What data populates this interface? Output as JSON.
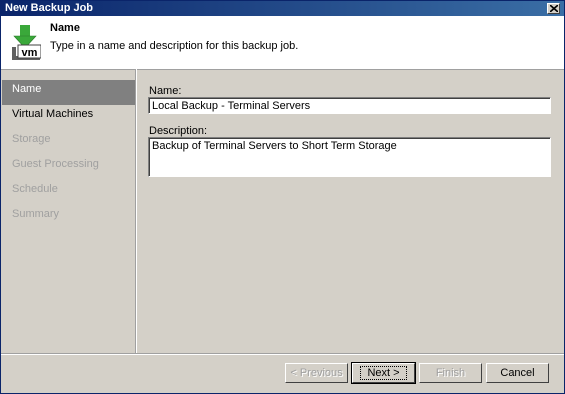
{
  "window": {
    "title": "New Backup Job"
  },
  "header": {
    "title": "Name",
    "description": "Type in a name and description for this backup job.",
    "icon": "vm-backup-icon"
  },
  "sidebar": {
    "items": [
      {
        "label": "Name",
        "state": "active"
      },
      {
        "label": "Virtual Machines",
        "state": "enabled"
      },
      {
        "label": "Storage",
        "state": "disabled"
      },
      {
        "label": "Guest Processing",
        "state": "disabled"
      },
      {
        "label": "Schedule",
        "state": "disabled"
      },
      {
        "label": "Summary",
        "state": "disabled"
      }
    ]
  },
  "form": {
    "name_label": "Name:",
    "name_value": "Local Backup - Terminal Servers",
    "description_label": "Description:",
    "description_value": "Backup of Terminal Servers to Short Term Storage"
  },
  "buttons": {
    "previous": "< Previous",
    "next": "Next >",
    "finish": "Finish",
    "cancel": "Cancel"
  },
  "colors": {
    "titlebar": "#0a246a",
    "window_bg": "#d4d0c8",
    "active_item_bg": "#808080",
    "icon_green": "#3aa83a"
  }
}
